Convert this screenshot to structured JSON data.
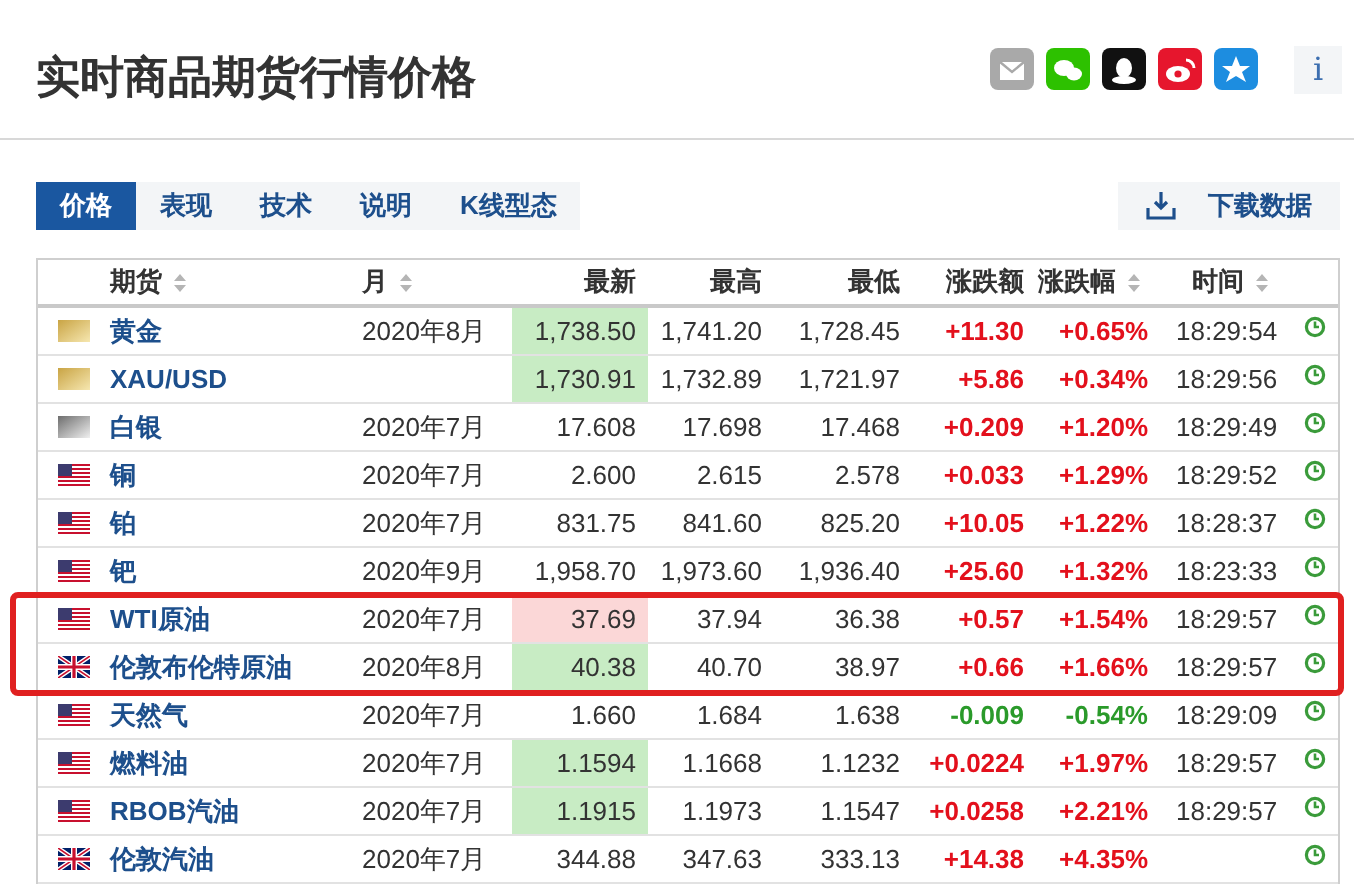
{
  "title": "实时商品期货行情价格",
  "share": [
    {
      "kind": "email"
    },
    {
      "kind": "wechat"
    },
    {
      "kind": "qq"
    },
    {
      "kind": "weibo"
    },
    {
      "kind": "star"
    }
  ],
  "info": "i",
  "tabs": [
    {
      "label": "价格",
      "selected": true
    },
    {
      "label": "表现",
      "selected": false
    },
    {
      "label": "技术",
      "selected": false
    },
    {
      "label": "说明",
      "selected": false
    },
    {
      "label": "K线型态",
      "selected": false
    }
  ],
  "download": "下载数据",
  "table": {
    "columns": [
      {
        "label": "期货",
        "sortable": true,
        "kind": "text"
      },
      {
        "label": "月",
        "sortable": true,
        "kind": "text"
      },
      {
        "label": "最新",
        "sortable": false,
        "kind": "number"
      },
      {
        "label": "最高",
        "sortable": false,
        "kind": "number"
      },
      {
        "label": "最低",
        "sortable": false,
        "kind": "number"
      },
      {
        "label": "涨跌额",
        "sortable": false,
        "kind": "number"
      },
      {
        "label": "涨跌幅",
        "sortable": true,
        "kind": "number"
      },
      {
        "label": "时间",
        "sortable": true,
        "kind": "text"
      }
    ],
    "rows": [
      {
        "kind": "gold",
        "name": "黄金",
        "month": "2020年8月",
        "last": "1,738.50",
        "last_rising": true,
        "last_falling": false,
        "high": "1,741.20",
        "low": "1,728.45",
        "change": "+11.30",
        "pct": "+0.65%",
        "rising": true,
        "time": "18:29:54",
        "highlighted": false
      },
      {
        "kind": "gold",
        "name": "XAU/USD",
        "last": "1,730.91",
        "last_rising": true,
        "last_falling": false,
        "high": "1,732.89",
        "low": "1,721.97",
        "change": "+5.86",
        "pct": "+0.34%",
        "rising": true,
        "time": "18:29:56",
        "highlighted": false
      },
      {
        "kind": "silver",
        "name": "白银",
        "month": "2020年7月",
        "last": "17.608",
        "last_rising": false,
        "last_falling": false,
        "high": "17.698",
        "low": "17.468",
        "change": "+0.209",
        "pct": "+1.20%",
        "rising": true,
        "time": "18:29:49",
        "highlighted": false
      },
      {
        "kind": "us",
        "name": "铜",
        "month": "2020年7月",
        "last": "2.600",
        "last_rising": false,
        "last_falling": false,
        "high": "2.615",
        "low": "2.578",
        "change": "+0.033",
        "pct": "+1.29%",
        "rising": true,
        "time": "18:29:52",
        "highlighted": false
      },
      {
        "kind": "us",
        "name": "铂",
        "month": "2020年7月",
        "last": "831.75",
        "last_rising": false,
        "last_falling": false,
        "high": "841.60",
        "low": "825.20",
        "change": "+10.05",
        "pct": "+1.22%",
        "rising": true,
        "time": "18:28:37",
        "highlighted": false
      },
      {
        "kind": "us",
        "name": "钯",
        "month": "2020年9月",
        "last": "1,958.70",
        "last_rising": false,
        "last_falling": false,
        "high": "1,973.60",
        "low": "1,936.40",
        "change": "+25.60",
        "pct": "+1.32%",
        "rising": true,
        "time": "18:23:33",
        "highlighted": false
      },
      {
        "kind": "us",
        "name": "WTI原油",
        "month": "2020年7月",
        "last": "37.69",
        "last_rising": false,
        "last_falling": true,
        "high": "37.94",
        "low": "36.38",
        "change": "+0.57",
        "pct": "+1.54%",
        "rising": true,
        "time": "18:29:57",
        "highlighted": true
      },
      {
        "kind": "uk",
        "name": "伦敦布伦特原油",
        "month": "2020年8月",
        "last": "40.38",
        "last_rising": true,
        "last_falling": false,
        "high": "40.70",
        "low": "38.97",
        "change": "+0.66",
        "pct": "+1.66%",
        "rising": true,
        "time": "18:29:57",
        "highlighted": true
      },
      {
        "kind": "us",
        "name": "天然气",
        "month": "2020年7月",
        "last": "1.660",
        "last_rising": false,
        "last_falling": false,
        "high": "1.684",
        "low": "1.638",
        "change": "-0.009",
        "pct": "-0.54%",
        "rising": false,
        "time": "18:29:09",
        "highlighted": false
      },
      {
        "kind": "us",
        "name": "燃料油",
        "month": "2020年7月",
        "last": "1.1594",
        "last_rising": true,
        "last_falling": false,
        "high": "1.1668",
        "low": "1.1232",
        "change": "+0.0224",
        "pct": "+1.97%",
        "rising": true,
        "time": "18:29:57",
        "highlighted": false
      },
      {
        "kind": "us",
        "name": "RBOB汽油",
        "month": "2020年7月",
        "last": "1.1915",
        "last_rising": true,
        "last_falling": false,
        "high": "1.1973",
        "low": "1.1547",
        "change": "+0.0258",
        "pct": "+2.21%",
        "rising": true,
        "time": "18:29:57",
        "highlighted": false
      },
      {
        "kind": "uk",
        "name": "伦敦汽油",
        "month": "2020年7月",
        "last": "344.88",
        "last_rising": false,
        "last_falling": false,
        "high": "347.63",
        "low": "333.13",
        "change": "+14.38",
        "pct": "+4.35%",
        "rising": true,
        "highlighted": false
      }
    ]
  }
}
